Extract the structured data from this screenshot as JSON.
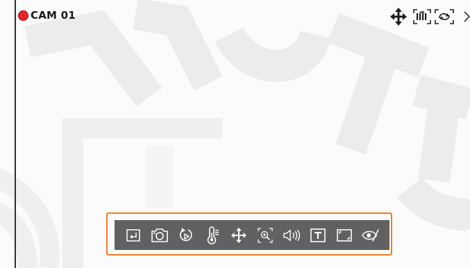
{
  "camera": {
    "name": "CAM 01",
    "recording": true,
    "recording_color": "#e8262b"
  },
  "overlay_icons": [
    "ptz-move-icon",
    "video-grid-icon",
    "rotate-view-icon",
    "chevron-right-icon"
  ],
  "toolbar": {
    "highlight_color": "#f07b28",
    "background": "#616161",
    "items": [
      {
        "name": "exit-icon"
      },
      {
        "name": "snapshot-icon"
      },
      {
        "name": "instant-playback-icon"
      },
      {
        "name": "thermal-icon"
      },
      {
        "name": "ptz-icon"
      },
      {
        "name": "digital-zoom-icon"
      },
      {
        "name": "audio-icon"
      },
      {
        "name": "text-icon"
      },
      {
        "name": "aspect-ratio-icon"
      },
      {
        "name": "privacy-icon"
      }
    ]
  },
  "colors": {
    "viewport_bg": "#fbfbfb",
    "frame_line": "#2e2e2e",
    "icon_dark": "#333333"
  }
}
